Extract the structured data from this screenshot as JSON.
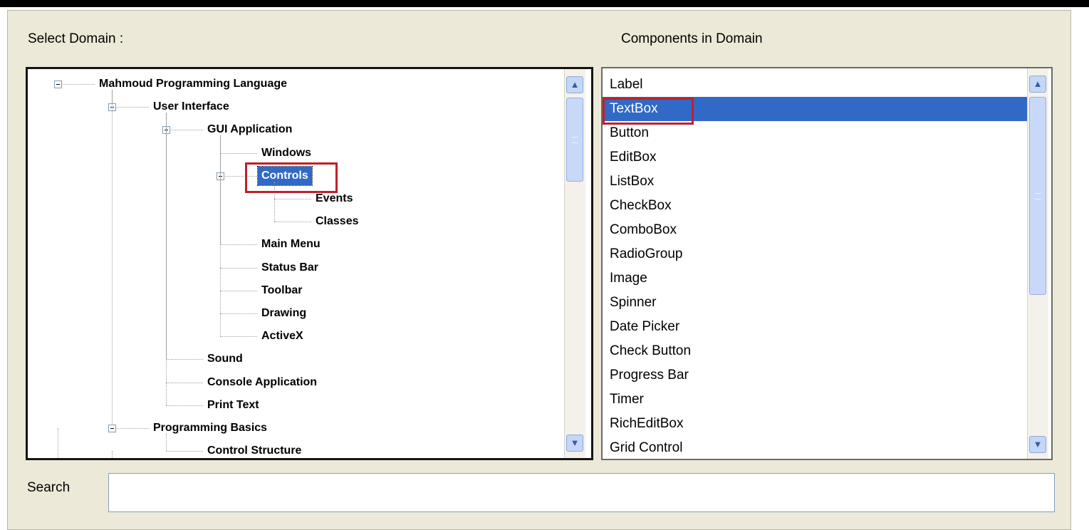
{
  "select_domain_label": "Select Domain :",
  "components_label": "Components in Domain",
  "search": {
    "label": "Search",
    "value": ""
  },
  "tree": {
    "nodes": [
      {
        "label": "Mahmoud Programming Language",
        "level": 0,
        "expanded": true,
        "selected": false
      },
      {
        "label": "User Interface",
        "level": 1,
        "expanded": true,
        "selected": false
      },
      {
        "label": "GUI Application",
        "level": 2,
        "expanded": true,
        "selected": false
      },
      {
        "label": "Windows",
        "level": 3,
        "expanded": null,
        "selected": false
      },
      {
        "label": "Controls",
        "level": 3,
        "expanded": true,
        "selected": true
      },
      {
        "label": "Events",
        "level": 4,
        "expanded": null,
        "selected": false
      },
      {
        "label": "Classes",
        "level": 4,
        "expanded": null,
        "selected": false
      },
      {
        "label": "Main Menu",
        "level": 3,
        "expanded": null,
        "selected": false
      },
      {
        "label": "Status Bar",
        "level": 3,
        "expanded": null,
        "selected": false
      },
      {
        "label": "Toolbar",
        "level": 3,
        "expanded": null,
        "selected": false
      },
      {
        "label": "Drawing",
        "level": 3,
        "expanded": null,
        "selected": false
      },
      {
        "label": "ActiveX",
        "level": 3,
        "expanded": null,
        "selected": false
      },
      {
        "label": "Sound",
        "level": 2,
        "expanded": null,
        "selected": false
      },
      {
        "label": "Console Application",
        "level": 2,
        "expanded": null,
        "selected": false
      },
      {
        "label": "Print Text",
        "level": 2,
        "expanded": null,
        "selected": false
      },
      {
        "label": "Programming Basics",
        "level": 1,
        "expanded": true,
        "selected": false
      },
      {
        "label": "Control Structure",
        "level": 2,
        "expanded": null,
        "selected": false
      }
    ]
  },
  "components": {
    "items": [
      "Label",
      "TextBox",
      "Button",
      "EditBox",
      "ListBox",
      "CheckBox",
      "ComboBox",
      "RadioGroup",
      "Image",
      "Spinner",
      "Date Picker",
      "Check Button",
      "Progress Bar",
      "Timer",
      "RichEditBox",
      "Grid Control"
    ],
    "selected_index": 1
  },
  "colors": {
    "selection": "#3169c6",
    "highlight_box": "#c0202a",
    "panel_bg": "#ece9d8"
  },
  "icons": {
    "scroll_up": "chevron-up-icon",
    "scroll_down": "chevron-down-icon",
    "tree_toggle": "minus-box-icon"
  }
}
